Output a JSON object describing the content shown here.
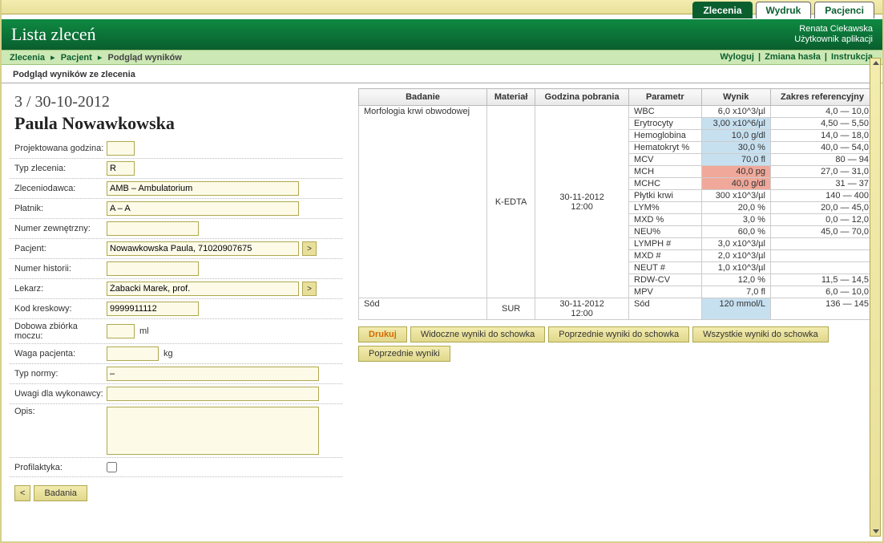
{
  "tabs": {
    "zlecenia": "Zlecenia",
    "wydruk": "Wydruk",
    "pacjenci": "Pacjenci"
  },
  "header": {
    "title": "Lista zleceń"
  },
  "user": {
    "name": "Renata Ciekawska",
    "role": "Użytkownik aplikacji"
  },
  "crumbs": {
    "a": "Zlecenia",
    "b": "Pacjent",
    "c": "Podgląd wyników"
  },
  "links": {
    "wyloguj": "Wyloguj",
    "zmiana": "Zmiana hasła",
    "instrukcja": "Instrukcja"
  },
  "section": "Podgląd wyników ze zlecenia",
  "order": {
    "id": "3 / 30-10-2012",
    "patient": "Paula Nowawkowska"
  },
  "form": {
    "labels": {
      "projektowana": "Projektowana godzina:",
      "typ": "Typ zlecenia:",
      "zleceniodawca": "Zleceniodawca:",
      "platnik": "Płatnik:",
      "numerzew": "Numer zewnętrzny:",
      "pacjent": "Pacjent:",
      "numerhist": "Numer historii:",
      "lekarz": "Lekarz:",
      "kod": "Kod kreskowy:",
      "dobowa": "Dobowa zbiórka moczu:",
      "waga": "Waga pacjenta:",
      "typnormy": "Typ normy:",
      "uwagi": "Uwagi dla wykonawcy:",
      "opis": "Opis:",
      "profilaktyka": "Profilaktyka:"
    },
    "values": {
      "typ": "R",
      "zleceniodawca": "AMB – Ambulatorium",
      "platnik": "A – A",
      "pacjent": "Nowawkowska Paula, 71020907675",
      "lekarz": "Żabacki Marek, prof.",
      "kod": "9999911112",
      "typnormy": "–"
    },
    "units": {
      "ml": "ml",
      "kg": "kg"
    }
  },
  "go": ">",
  "back": "<",
  "badania": "Badania",
  "table": {
    "headers": {
      "badanie": "Badanie",
      "material": "Materiał",
      "godzina": "Godzina pobrania",
      "parametr": "Parametr",
      "wynik": "Wynik",
      "zakres": "Zakres referencyjny"
    },
    "group1": {
      "badanie": "Morfologia krwi obwodowej",
      "material": "K-EDTA",
      "godzina": "30-11-2012 12:00"
    },
    "rows1": [
      {
        "param": "WBC",
        "val": "6,0 x10^3/µl",
        "ref": "4,0 — 10,0",
        "cls": ""
      },
      {
        "param": "Erytrocyty",
        "val": "3,00 x10^6/µl",
        "ref": "4,50 — 5,50",
        "cls": "blue"
      },
      {
        "param": "Hemoglobina",
        "val": "10,0 g/dl",
        "ref": "14,0 — 18,0",
        "cls": "blue"
      },
      {
        "param": "Hematokryt %",
        "val": "30,0 %",
        "ref": "40,0 — 54,0",
        "cls": "blue"
      },
      {
        "param": "MCV",
        "val": "70,0 fl",
        "ref": "80 — 94",
        "cls": "blue"
      },
      {
        "param": "MCH",
        "val": "40,0 pg",
        "ref": "27,0 — 31,0",
        "cls": "red"
      },
      {
        "param": "MCHC",
        "val": "40,0 g/dl",
        "ref": "31 — 37",
        "cls": "red"
      },
      {
        "param": "Płytki krwi",
        "val": "300 x10^3/µl",
        "ref": "140 — 400",
        "cls": ""
      },
      {
        "param": "LYM%",
        "val": "20,0 %",
        "ref": "20,0 — 45,0",
        "cls": ""
      },
      {
        "param": "MXD %",
        "val": "3,0 %",
        "ref": "0,0 — 12,0",
        "cls": ""
      },
      {
        "param": "NEU%",
        "val": "60,0 %",
        "ref": "45,0 — 70,0",
        "cls": ""
      },
      {
        "param": "LYMPH #",
        "val": "3,0 x10^3/µl",
        "ref": "",
        "cls": ""
      },
      {
        "param": "MXD #",
        "val": "2,0 x10^3/µl",
        "ref": "",
        "cls": ""
      },
      {
        "param": "NEUT #",
        "val": "1,0 x10^3/µl",
        "ref": "",
        "cls": ""
      },
      {
        "param": "RDW-CV",
        "val": "12,0 %",
        "ref": "11,5 — 14,5",
        "cls": ""
      },
      {
        "param": "MPV",
        "val": "7,0 fl",
        "ref": "6,0 — 10,0",
        "cls": ""
      }
    ],
    "group2": {
      "badanie": "Sód",
      "material": "SUR",
      "godzina": "30-11-2012 12:00"
    },
    "rows2": [
      {
        "param": "Sód",
        "val": "120 mmol/L",
        "ref": "136 — 145",
        "cls": "blue"
      }
    ]
  },
  "resultbtns": {
    "drukuj": "Drukuj",
    "widoczne": "Widoczne wyniki do schowka",
    "poprzednie": "Poprzednie wyniki do schowka",
    "wszystkie": "Wszystkie wyniki do schowka",
    "poprzedniew": "Poprzednie wyniki"
  }
}
